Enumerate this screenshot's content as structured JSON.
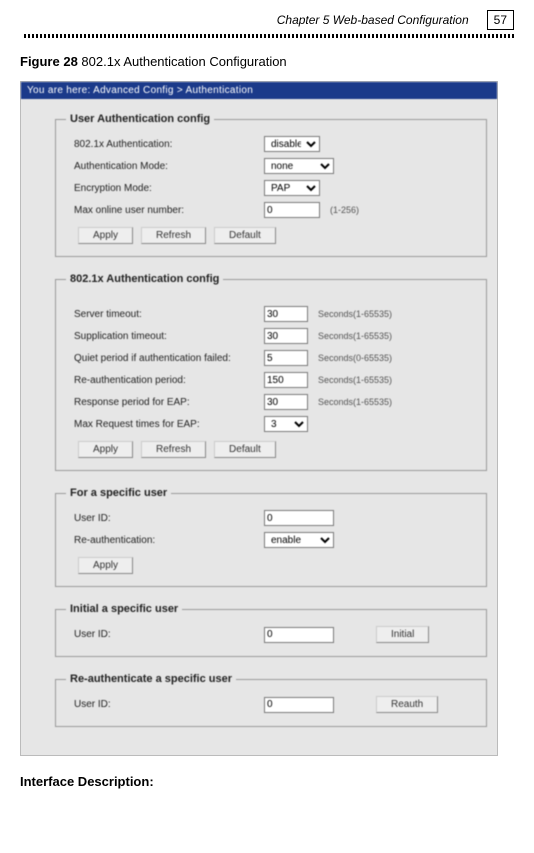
{
  "header": {
    "chapter": "Chapter 5 Web-based Configuration",
    "page_number": "57"
  },
  "figure_caption_bold": "Figure 28",
  "figure_caption_text": " 802.1x Authentication Configuration",
  "window": {
    "titlebar": "You are here: Advanced Config > Authentication",
    "group_user_auth": {
      "legend": "User Authentication config",
      "row1_label": "802.1x Authentication:",
      "row1_value": "disable",
      "row2_label": "Authentication Mode:",
      "row2_value": "none",
      "row3_label": "Encryption Mode:",
      "row3_value": "PAP",
      "row4_label": "Max online user number:",
      "row4_value": "0",
      "row4_hint": "(1-256)",
      "btn_apply": "Apply",
      "btn_refresh": "Refresh",
      "btn_default": "Default"
    },
    "group_8021x": {
      "legend": "802.1x Authentication config",
      "row1_label": "Server timeout:",
      "row1_value": "30",
      "row1_hint": "Seconds(1-65535)",
      "row2_label": "Supplication timeout:",
      "row2_value": "30",
      "row2_hint": "Seconds(1-65535)",
      "row3_label": "Quiet period if authentication failed:",
      "row3_value": "5",
      "row3_hint": "Seconds(0-65535)",
      "row4_label": "Re-authentication period:",
      "row4_value": "150",
      "row4_hint": "Seconds(1-65535)",
      "row5_label": "Response period for EAP:",
      "row5_value": "30",
      "row5_hint": "Seconds(1-65535)",
      "row6_label": "Max Request times for EAP:",
      "row6_value": "3",
      "btn_apply": "Apply",
      "btn_refresh": "Refresh",
      "btn_default": "Default"
    },
    "group_specific": {
      "legend": "For a specific user",
      "row1_label": "User ID:",
      "row1_value": "0",
      "row2_label": "Re-authentication:",
      "row2_value": "enable",
      "btn_apply": "Apply"
    },
    "group_initial": {
      "legend": "Initial a specific user",
      "row1_label": "User ID:",
      "row1_value": "0",
      "btn_initial": "Initial"
    },
    "group_reauth": {
      "legend": "Re-authenticate a specific user",
      "row1_label": "User ID:",
      "row1_value": "0",
      "btn_reauth": "Reauth"
    }
  },
  "footer_heading": "Interface Description:"
}
